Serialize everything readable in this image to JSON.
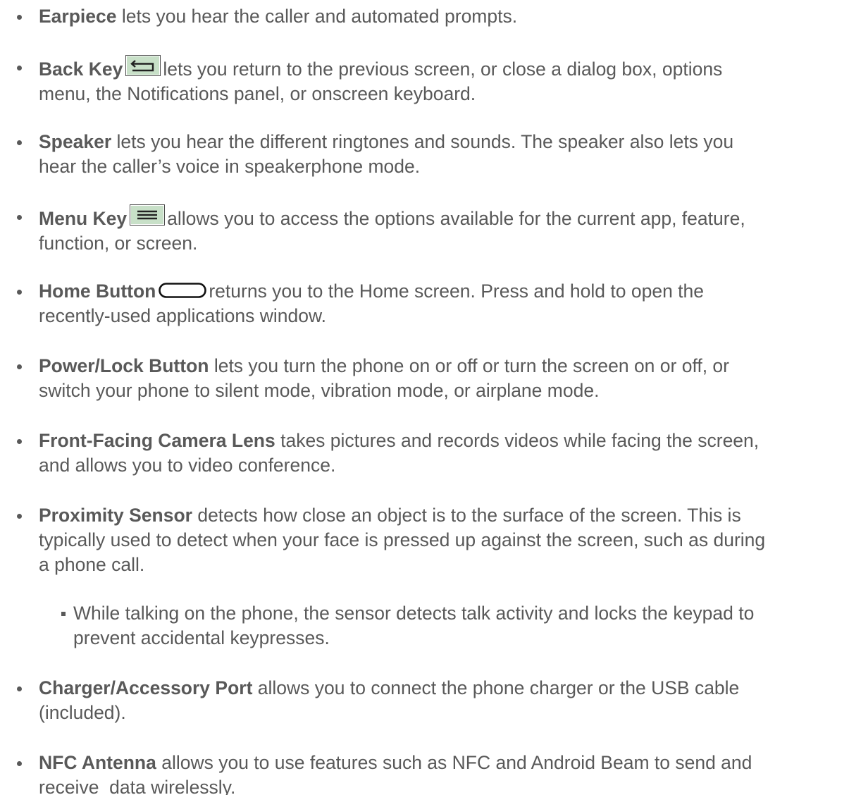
{
  "items": [
    {
      "term": "Earpiece",
      "desc": " lets you hear the caller and automated prompts."
    },
    {
      "term": "Back Key",
      "icon": "back-arrow-icon",
      "line1": "lets you return to the previous screen, or close a dialog box, options",
      "line2": "menu, the Notifications panel, or onscreen keyboard."
    },
    {
      "term": "Speaker",
      "line1": " lets you hear the different ringtones and sounds. The speaker also lets you",
      "line2": "hear the caller’s voice in speakerphone mode."
    },
    {
      "term": "Menu Key",
      "icon": "menu-lines-icon",
      "line1": "allows you to access the options available for the current app, feature,",
      "line2": "function, or screen."
    },
    {
      "term": "Home Button",
      "icon": "home-button-icon",
      "line1": "returns you to the Home screen. Press and hold to open the",
      "line2": "recently-used applications window."
    },
    {
      "term": "Power/Lock Button",
      "line1": " lets you turn the phone on or off or turn the screen on or off, or",
      "line2": "switch your phone to silent mode, vibration mode, or airplane mode."
    },
    {
      "term": "Front-Facing Camera Lens",
      "line1": " takes pictures and records videos while facing the screen,",
      "line2": "and allows you to video conference."
    },
    {
      "term": "Proximity Sensor",
      "line1": " detects how close an object is to the surface of the screen. This is",
      "line2": "typically used to detect when your face is pressed up against the screen, such as during",
      "line3": "a phone call."
    },
    {
      "sub_line1": "While talking on the phone, the sensor detects talk activity and locks the keypad to",
      "sub_line2": "prevent accidental keypresses."
    },
    {
      "term": "Charger/Accessory Port",
      "line1": " allows you to connect the phone charger or the USB cable",
      "line2": "(included)."
    },
    {
      "term": "NFC Antenna",
      "line1": " allows you to use features such as NFC and Android Beam to send and",
      "line2": "receive  data wirelessly."
    }
  ],
  "colors": {
    "text": "#595959",
    "icon_fill": "#c8e0c8"
  }
}
